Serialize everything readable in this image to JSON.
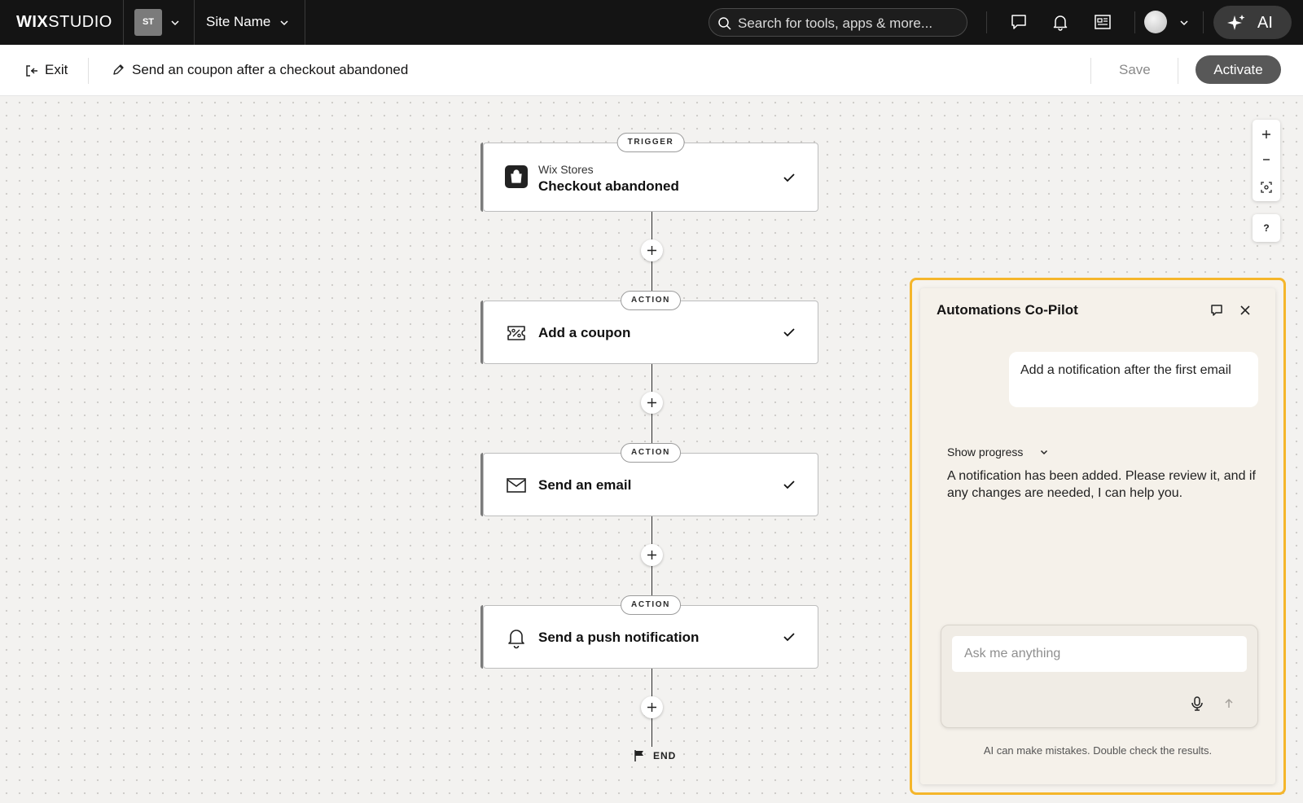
{
  "topbar": {
    "logo_bold": "WIX",
    "logo_light": "STUDIO",
    "site_initials": "ST",
    "site_name": "Site Name",
    "search_placeholder": "Search for tools, apps & more...",
    "ai_label": "AI",
    "icons": [
      "chat-icon",
      "bell-icon",
      "news-icon",
      "user-avatar",
      "sparkle-icon"
    ]
  },
  "subbar": {
    "exit_label": "Exit",
    "flow_title": "Send an coupon after a checkout abandoned",
    "save_label": "Save",
    "activate_label": "Activate"
  },
  "flow": {
    "nodes": [
      {
        "badge": "TRIGGER",
        "app": "Wix Stores",
        "label": "Checkout abandoned",
        "icon": "shopping-bag-icon",
        "status": "check"
      },
      {
        "badge": "ACTION",
        "label": "Add a coupon",
        "icon": "coupon-icon",
        "status": "check"
      },
      {
        "badge": "ACTION",
        "label": "Send an email",
        "icon": "envelope-icon",
        "status": "check"
      },
      {
        "badge": "ACTION",
        "label": "Send a push notification",
        "icon": "bell-icon",
        "status": "check"
      }
    ],
    "end_label": "END"
  },
  "zoom_controls": {
    "help_label": "?"
  },
  "copilot": {
    "title": "Automations Co-Pilot",
    "user_message": "Add a notification after the first email",
    "progress_label": "Show progress",
    "assistant_message": "A notification has been added. Please review it, and if any changes are needed, I can help you.",
    "input_placeholder": "Ask me anything",
    "disclaimer": "AI can make mistakes. Double check the results."
  },
  "colors": {
    "topbar_bg": "#141414",
    "canvas_bg": "#f3f2f0",
    "highlight_border": "#f5b62b",
    "activate_bg": "#585858"
  }
}
